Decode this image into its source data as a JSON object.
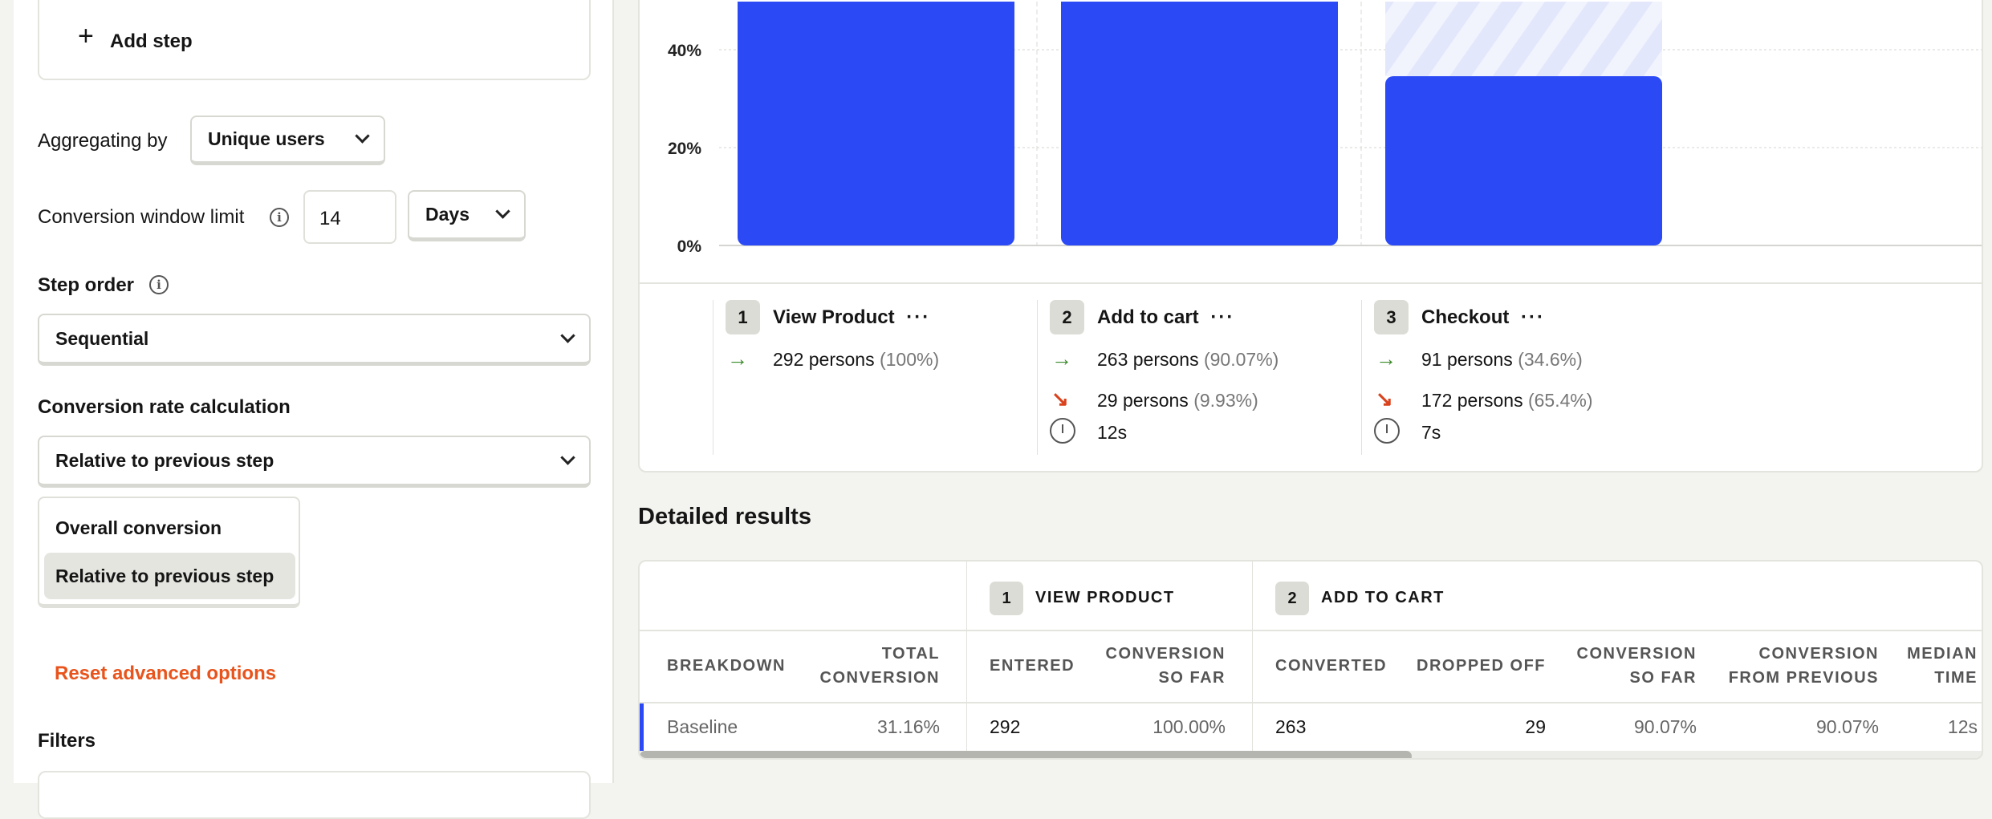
{
  "sidebar": {
    "add_step": "Add step",
    "aggregating_label": "Aggregating by",
    "aggregating_value": "Unique users",
    "window_label": "Conversion window limit",
    "window_value": "14",
    "window_unit": "Days",
    "step_order_label": "Step order",
    "step_order_value": "Sequential",
    "calc_label": "Conversion rate calculation",
    "calc_value": "Relative to previous step",
    "calc_options": [
      "Overall conversion",
      "Relative to previous step"
    ],
    "reset_label": "Reset advanced options",
    "filters_label": "Filters"
  },
  "colors": {
    "accent": "#2b4af5",
    "reset": "#e8541c",
    "up": "#3b8a2a",
    "down": "#d9421c"
  },
  "chart_data": {
    "type": "bar",
    "categories": [
      "View Product",
      "Add to cart",
      "Checkout"
    ],
    "values": [
      100,
      90.07,
      34.6
    ],
    "yticks": [
      "0%",
      "20%",
      "40%"
    ],
    "ytick_values": [
      0,
      20,
      40
    ],
    "ylabel": "",
    "xlabel": "",
    "grid": true
  },
  "steps": [
    {
      "num": "1",
      "name": "View Product",
      "converted": "292 persons",
      "converted_pct": "(100%)"
    },
    {
      "num": "2",
      "name": "Add to cart",
      "converted": "263 persons",
      "converted_pct": "(90.07%)",
      "dropped": "29 persons",
      "dropped_pct": "(9.93%)",
      "time": "12s"
    },
    {
      "num": "3",
      "name": "Checkout",
      "converted": "91 persons",
      "converted_pct": "(34.6%)",
      "dropped": "172 persons",
      "dropped_pct": "(65.4%)",
      "time": "7s"
    }
  ],
  "results": {
    "title": "Detailed results",
    "groups": [
      {
        "num": "1",
        "name": "VIEW PRODUCT"
      },
      {
        "num": "2",
        "name": "ADD TO CART"
      }
    ],
    "columns": [
      "BREAKDOWN",
      "TOTAL CONVERSION",
      "ENTERED",
      "CONVERSION SO FAR",
      "CONVERTED",
      "DROPPED OFF",
      "CONVERSION SO FAR",
      "CONVERSION FROM PREVIOUS",
      "MEDIAN TIME"
    ],
    "row": [
      "Baseline",
      "31.16%",
      "292",
      "100.00%",
      "263",
      "29",
      "90.07%",
      "90.07%",
      "12s"
    ]
  }
}
